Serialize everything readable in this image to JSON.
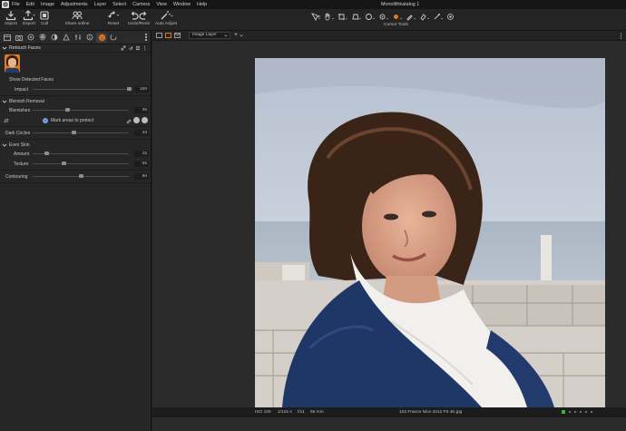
{
  "menu": [
    "File",
    "Edit",
    "Image",
    "Adjustments",
    "Layer",
    "Select",
    "Camera",
    "View",
    "Window",
    "Help"
  ],
  "document_title": "Monolithkatalog 1",
  "toolbar": {
    "import": "Import",
    "export": "Export",
    "cull": "Cull",
    "share": "Share online",
    "reset": "Reset",
    "undo_redo": "Undo/Redo",
    "auto_adjust": "Auto Adjust",
    "cursor_tools": "Cursor Tools"
  },
  "panel": {
    "tool_title": "Retouch Faces",
    "show_detected": "Show Detected Faces",
    "impact": {
      "label": "Impact",
      "value": "100",
      "level": 1.0
    },
    "blemish_section": "Blemish Removal",
    "blemishes": {
      "label": "Blemishes",
      "value": "36",
      "level": 0.36
    },
    "mark_areas": "Mark areas to protect",
    "dark_circles": {
      "label": "Dark Circles",
      "value": "43",
      "level": 0.43
    },
    "even_skin": "Even Skin",
    "amount": {
      "label": "Amount",
      "value": "15",
      "level": 0.15
    },
    "texture": {
      "label": "Texture",
      "value": "-35",
      "level": 0.325
    },
    "contouring": {
      "label": "Contouring",
      "value": "50",
      "level": 0.5
    }
  },
  "viewer": {
    "layer": "Image Layer",
    "add_layer": "+",
    "status": {
      "iso": "ISO 100",
      "shutter": "1/125 s",
      "aperture": "f/11",
      "focal": "55 mm",
      "filename": "102 France Nice 2012 P3 4K.jpg"
    }
  },
  "colors": {
    "accent_orange": "#e07a22",
    "info_blue": "#7aa4e8",
    "selected_green": "#3bb34a"
  },
  "icons": {
    "import": "download-icon",
    "export": "upload-icon",
    "cull": "cull-icon",
    "share": "people-icon",
    "reset": "reset-icon",
    "undo": "undo-icon",
    "redo": "redo-icon",
    "auto": "magic-wand-icon"
  }
}
